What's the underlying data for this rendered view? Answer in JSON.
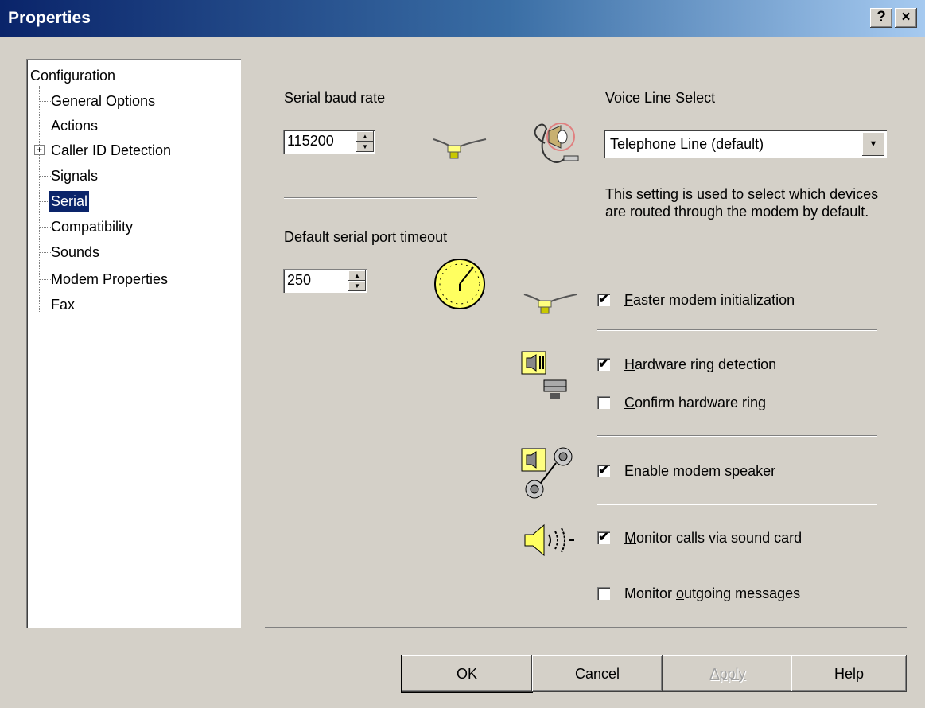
{
  "window": {
    "title": "Properties",
    "help_btn": "?",
    "close_btn": "×"
  },
  "tree": {
    "root": "Configuration",
    "items": [
      "General Options",
      "Actions",
      "Caller ID Detection",
      "Signals",
      "Serial",
      "Compatibility",
      "Sounds",
      "Modem Properties",
      "Fax"
    ],
    "selected": "Serial",
    "expander": "+"
  },
  "serial": {
    "baud_label": "Serial baud rate",
    "baud_value": "115200",
    "timeout_label": "Default serial port timeout",
    "timeout_value": "250"
  },
  "voice": {
    "label": "Voice Line Select",
    "selected": "Telephone Line (default)",
    "description": "This setting is used to select which devices are routed through the modem by default."
  },
  "options": [
    {
      "pre": "",
      "key": "F",
      "post": "aster modem initialization",
      "checked": true
    },
    {
      "pre": "",
      "key": "H",
      "post": "ardware ring detection",
      "checked": true
    },
    {
      "pre": "",
      "key": "C",
      "post": "onfirm hardware ring",
      "checked": false
    },
    {
      "pre": "Enable modem ",
      "key": "s",
      "post": "peaker",
      "checked": true
    },
    {
      "pre": "",
      "key": "M",
      "post": "onitor calls via sound card",
      "checked": true
    },
    {
      "pre": "Monitor ",
      "key": "o",
      "post": "utgoing messages",
      "checked": false
    }
  ],
  "buttons": {
    "ok": "OK",
    "cancel": "Cancel",
    "apply": "Apply",
    "help": "Help"
  },
  "icons": [
    "serial-connector-icon",
    "voice-line-icon",
    "clock-icon",
    "ring-detect-icon",
    "modem-speaker-icon",
    "sound-card-icon"
  ],
  "check_mark": "✔"
}
